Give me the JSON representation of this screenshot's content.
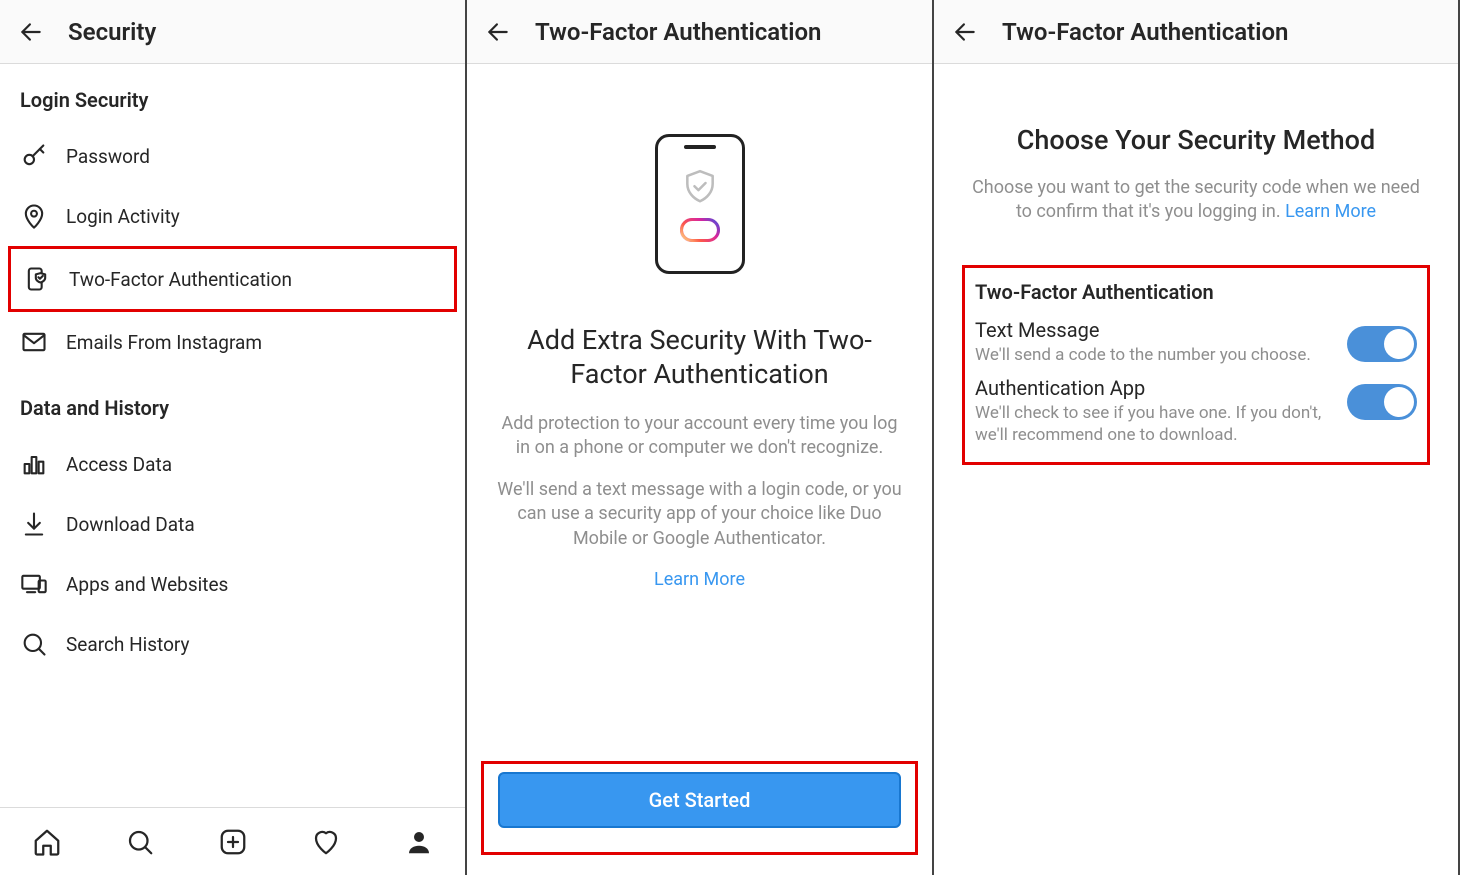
{
  "screen1": {
    "title": "Security",
    "sections": [
      {
        "heading": "Login Security",
        "items": [
          {
            "label": "Password"
          },
          {
            "label": "Login Activity"
          },
          {
            "label": "Two-Factor Authentication"
          },
          {
            "label": "Emails From Instagram"
          }
        ]
      },
      {
        "heading": "Data and History",
        "items": [
          {
            "label": "Access Data"
          },
          {
            "label": "Download Data"
          },
          {
            "label": "Apps and Websites"
          },
          {
            "label": "Search History"
          }
        ]
      }
    ]
  },
  "screen2": {
    "title": "Two-Factor Authentication",
    "heading": "Add Extra Security With Two-Factor Authentication",
    "desc1": "Add protection to your account every time you log in on a phone or computer we don't recognize.",
    "desc2": "We'll send a text message with a login code, or you can use a security app of your choice like Duo Mobile or Google Authenticator.",
    "learn_more": "Learn More",
    "cta": "Get Started"
  },
  "screen3": {
    "title": "Two-Factor Authentication",
    "heading": "Choose Your Security Method",
    "desc": "Choose you want to get the security code when we need to confirm that it's you logging in. ",
    "learn_more": "Learn More",
    "box_title": "Two-Factor Authentication",
    "options": [
      {
        "title": "Text Message",
        "sub": "We'll send a code to the number you choose."
      },
      {
        "title": "Authentication App",
        "sub": "We'll check to see if you have one. If you don't, we'll recommend one to download."
      }
    ]
  }
}
